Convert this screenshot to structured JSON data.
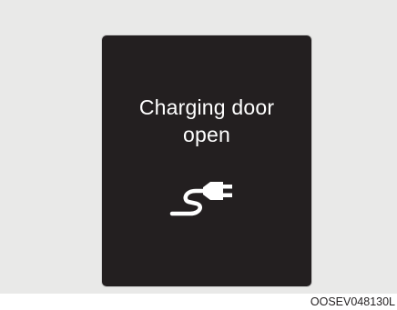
{
  "message": {
    "line1": "Charging door",
    "line2": "open"
  },
  "icon": "charging-plug-icon",
  "figure_code": "OOSEV048130L",
  "colors": {
    "background": "#e9e9e8",
    "panel": "#231f20",
    "text": "#ffffff"
  }
}
